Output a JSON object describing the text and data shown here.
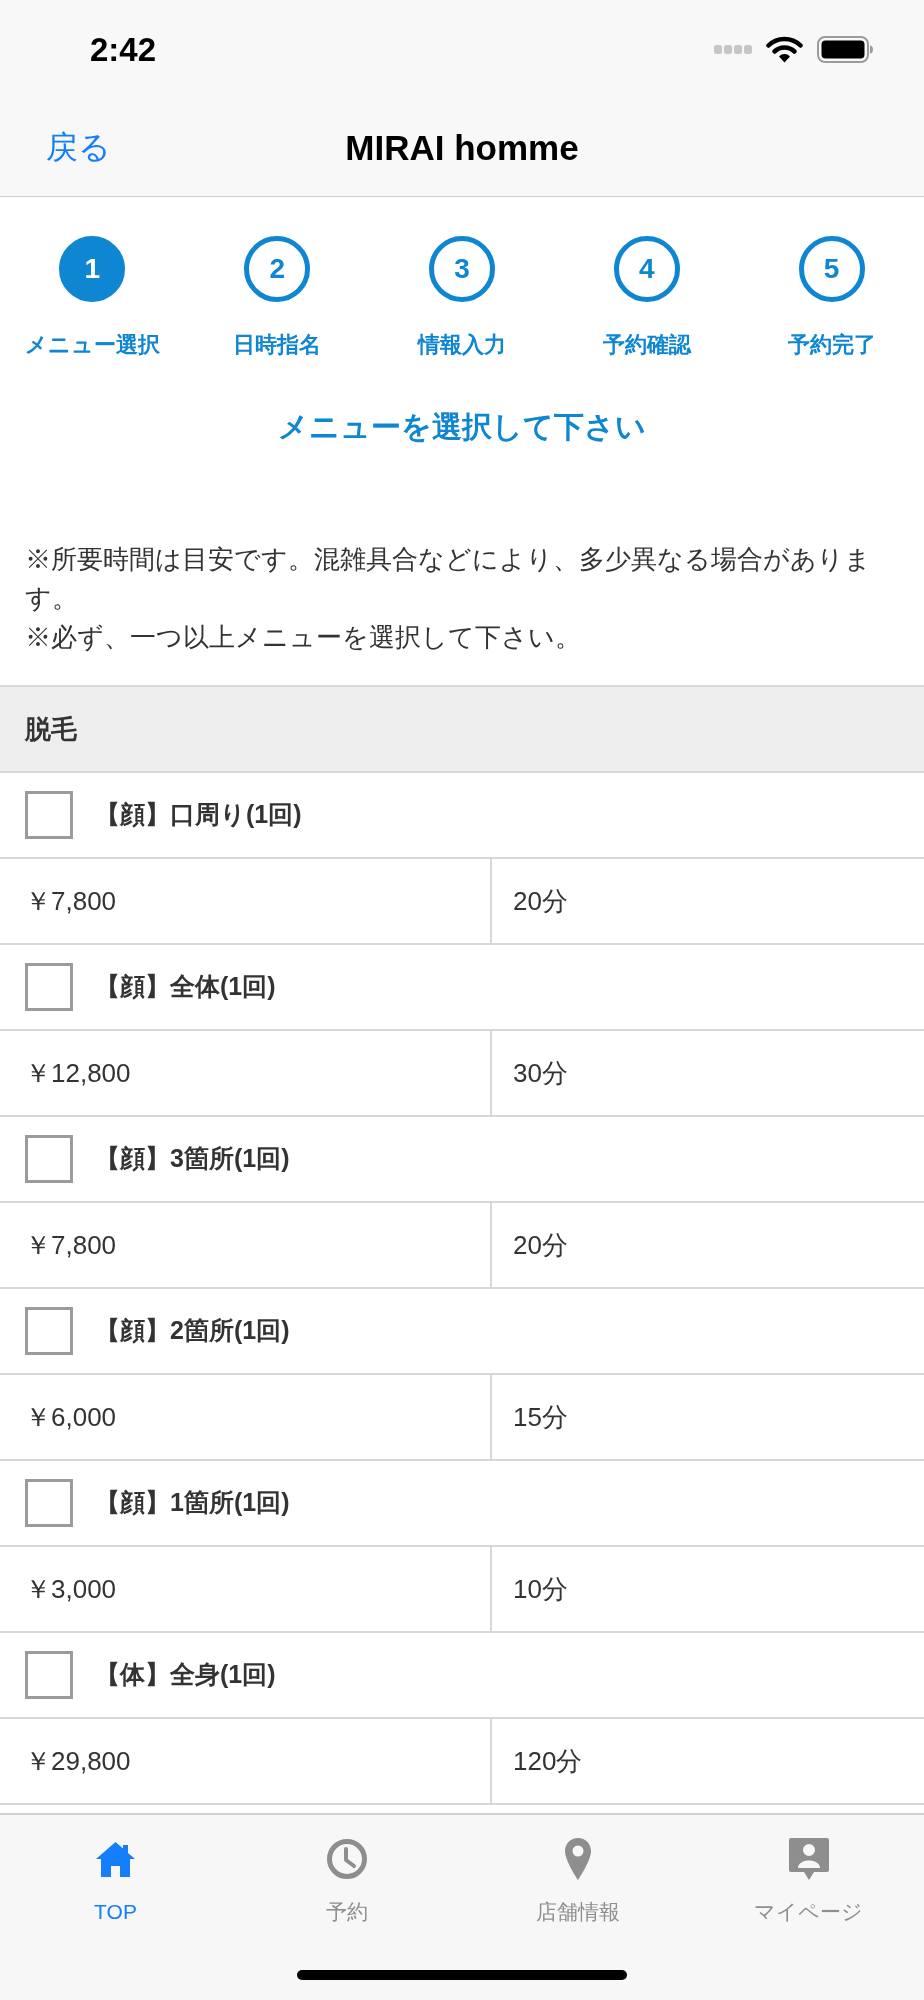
{
  "status_bar": {
    "time": "2:42"
  },
  "nav_bar": {
    "back": "戻る",
    "title": "MIRAI homme"
  },
  "steps": [
    {
      "number": "1",
      "label": "メニュー選択",
      "selected": true
    },
    {
      "number": "2",
      "label": "日時指名",
      "selected": false
    },
    {
      "number": "3",
      "label": "情報入力",
      "selected": false
    },
    {
      "number": "4",
      "label": "予約確認",
      "selected": false
    },
    {
      "number": "5",
      "label": "予約完了",
      "selected": false
    }
  ],
  "heading": "メニューを選択して下さい",
  "notes": [
    "※所要時間は目安です。混雑具合などにより、多少異なる場合があります。",
    "※必ず、一つ以上メニューを選択して下さい。"
  ],
  "sections": [
    {
      "title": "脱毛",
      "items": [
        {
          "name": "【顔】口周り(1回)",
          "checked": false,
          "price": "￥7,800",
          "duration": "20分"
        },
        {
          "name": "【顔】全体(1回)",
          "checked": false,
          "price": "￥12,800",
          "duration": "30分"
        },
        {
          "name": "【顔】3箇所(1回)",
          "checked": false,
          "price": "￥7,800",
          "duration": "20分"
        },
        {
          "name": "【顔】2箇所(1回)",
          "checked": false,
          "price": "￥6,000",
          "duration": "15分"
        },
        {
          "name": "【顔】1箇所(1回)",
          "checked": false,
          "price": "￥3,000",
          "duration": "10分"
        },
        {
          "name": "【体】全身(1回)",
          "checked": false,
          "price": "￥29,800",
          "duration": "120分"
        }
      ]
    }
  ],
  "tab_bar": [
    {
      "label": "TOP",
      "kind": "home",
      "selected": true
    },
    {
      "label": "予約",
      "kind": "clock",
      "selected": false
    },
    {
      "label": "店舗情報",
      "kind": "pin",
      "selected": false
    },
    {
      "label": "マイページ",
      "kind": "profile",
      "selected": false
    }
  ]
}
